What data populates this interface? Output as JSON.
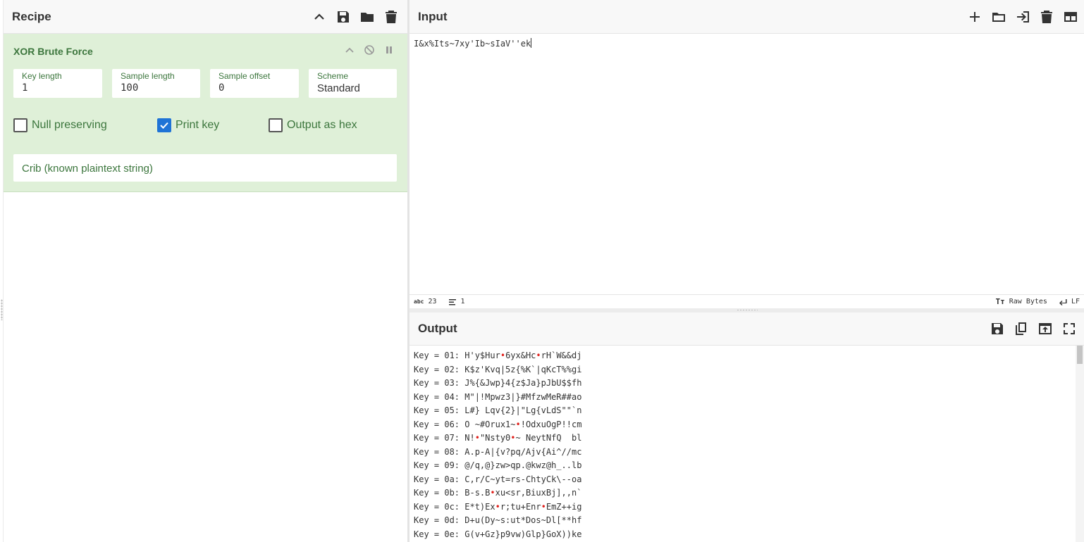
{
  "recipe": {
    "title": "Recipe",
    "icons": [
      "chevron-up-icon",
      "save-icon",
      "folder-icon",
      "trash-icon"
    ],
    "operation": {
      "name": "XOR Brute Force",
      "fields": [
        {
          "label": "Key length",
          "value": "1"
        },
        {
          "label": "Sample length",
          "value": "100"
        },
        {
          "label": "Sample offset",
          "value": "0"
        },
        {
          "label": "Scheme",
          "value": "Standard"
        }
      ],
      "checkboxes": [
        {
          "label": "Null preserving",
          "checked": false
        },
        {
          "label": "Print key",
          "checked": true
        },
        {
          "label": "Output as hex",
          "checked": false
        }
      ],
      "crib_placeholder": "Crib (known plaintext string)"
    }
  },
  "input": {
    "title": "Input",
    "text": "I&x%Its~7xy'Ib~sIaV''ek",
    "status": {
      "length": "23",
      "lines": "1",
      "encoding": "Raw Bytes",
      "eol": "LF"
    }
  },
  "output": {
    "title": "Output",
    "lines": [
      [
        "Key = 01: H'y$Hur",
        "•",
        "6yx&Hc",
        "•",
        "rH`W&&dj"
      ],
      [
        "Key = 02: K$z'Kvq|5z{%K`|qKcT%%gi"
      ],
      [
        "Key = 03: J%{&Jwp}4{z$Ja}pJbU$$fh"
      ],
      [
        "Key = 04: M\"|!Mpwz3|}#MfzwMeR##ao"
      ],
      [
        "Key = 05: L#} Lqv{2}|\"Lg{vLdS\"\"`n"
      ],
      [
        "Key = 06: O ~#Orux1~",
        "•",
        "!OdxuOgP!!cm"
      ],
      [
        "Key = 07: N!",
        "•",
        "\"Nsty0",
        "•",
        "~ NeytNfQ  bl"
      ],
      [
        "Key = 08: A.p-A|{v?pq/Ajv{Ai^//mc"
      ],
      [
        "Key = 09: @/q,@}zw>qp.@kwz@h_..lb"
      ],
      [
        "Key = 0a: C,r/C~yt=rs-ChtyCk\\--oa"
      ],
      [
        "Key = 0b: B-s.B",
        "•",
        "xu<sr,BiuxBj],,n`"
      ],
      [
        "Key = 0c: E*t)Ex",
        "•",
        "r;tu+Enr",
        "•",
        "EmZ++ig"
      ],
      [
        "Key = 0d: D+u(Dy~s:ut*Dos~Dl[**hf"
      ],
      [
        "Key = 0e: G(v+Gz}p9vw)Glp}GoX))ke"
      ]
    ]
  }
}
